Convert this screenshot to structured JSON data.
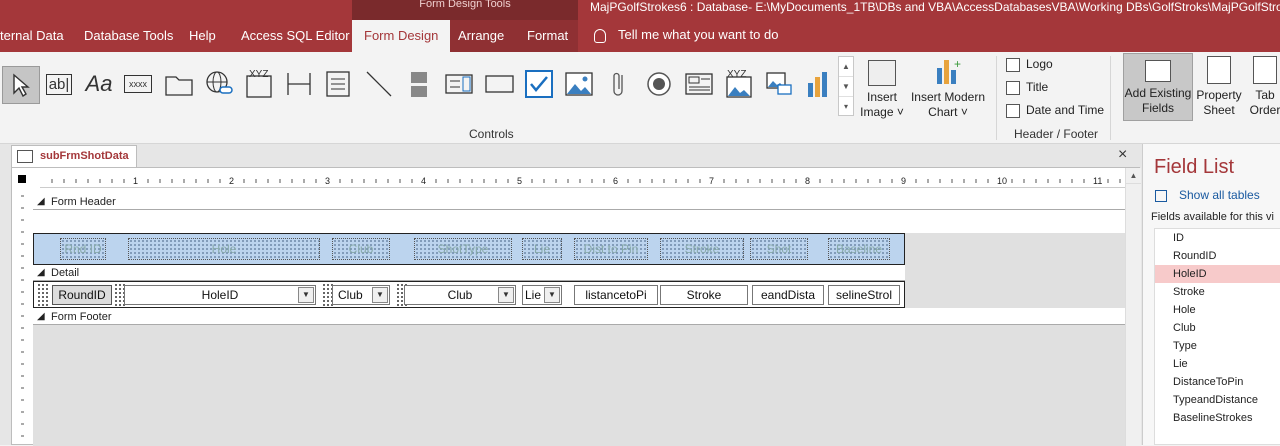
{
  "app": {
    "context_tools": "Form Design Tools",
    "title": "MajPGolfStrokes6 : Database- E:\\MyDocuments_1TB\\DBs and VBA\\AccessDatabasesVBA\\Working DBs\\GolfStroks\\MajPGolfStrokes6",
    "tabs": [
      {
        "label": "ternal Data"
      },
      {
        "label": "Database Tools"
      },
      {
        "label": "Help"
      },
      {
        "label": "Access SQL Editor"
      },
      {
        "label": "Form Design"
      },
      {
        "label": "Arrange"
      },
      {
        "label": "Format"
      }
    ],
    "tell_me": "Tell me what you want to do"
  },
  "ribbon": {
    "controls_group_label": "Controls",
    "header_footer_group_label": "Header / Footer",
    "insert_image": {
      "line1": "Insert",
      "line2": "Image ˅"
    },
    "insert_chart": {
      "line1": "Insert Modern",
      "line2": "Chart ˅"
    },
    "logo": "Logo",
    "title": "Title",
    "date_time": "Date and Time",
    "add_existing": {
      "line1": "Add Existing",
      "line2": "Fields"
    },
    "property_sheet": {
      "line1": "Property",
      "line2": "Sheet"
    },
    "tab_order": {
      "line1": "Tab",
      "line2": "Order"
    },
    "textbox_icon": "ab|",
    "label_icon": "Aa",
    "xxxx_icon": "xxxx",
    "xyz_icon": "XYZ"
  },
  "document": {
    "tab_label": "subFrmShotData",
    "close": "×",
    "ruler_numbers": [
      "1",
      "2",
      "3",
      "4",
      "5",
      "6",
      "7",
      "8",
      "9",
      "10",
      "11"
    ],
    "sections": {
      "header": "Form Header",
      "detail": "Detail",
      "footer": "Form Footer"
    },
    "header_labels": [
      "Rnd ID",
      "Hole",
      "Club",
      "ShotType",
      "Lie",
      "Dist to Pin",
      "Stroke",
      "Shot",
      "Baseline"
    ],
    "detail_controls": [
      "RoundID",
      "HoleID",
      "Club",
      "Club",
      "Lie",
      "listancetoPi",
      "Stroke",
      "eandDista",
      "selineStrol"
    ]
  },
  "field_list": {
    "title": "Field List",
    "show_all": "Show all tables",
    "available": "Fields available for this vi",
    "fields": [
      "ID",
      "RoundID",
      "HoleID",
      "Stroke",
      "Hole",
      "Club",
      "Type",
      "Lie",
      "DistanceToPin",
      "TypeandDistance",
      "BaselineStrokes"
    ],
    "selected": "HoleID"
  }
}
